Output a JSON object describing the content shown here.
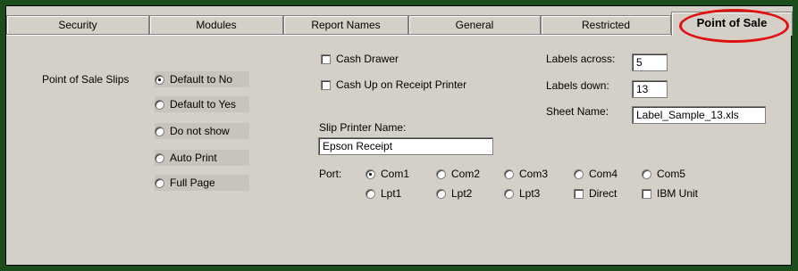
{
  "tabs": [
    {
      "label": "Security"
    },
    {
      "label": "Modules"
    },
    {
      "label": "Report Names"
    },
    {
      "label": "General"
    },
    {
      "label": "Restricted"
    },
    {
      "label": "Point of Sale",
      "active": true
    }
  ],
  "slips": {
    "label": "Point of Sale Slips",
    "options": [
      {
        "label": "Default to No",
        "selected": true
      },
      {
        "label": "Default to Yes",
        "selected": false
      },
      {
        "label": "Do not show",
        "selected": false
      },
      {
        "label": "Auto Print",
        "selected": false
      },
      {
        "label": "Full Page",
        "selected": false
      }
    ]
  },
  "checks": {
    "cash_drawer": {
      "label": "Cash Drawer",
      "checked": false
    },
    "cash_up": {
      "label": "Cash Up on Receipt Printer",
      "checked": false
    }
  },
  "slip_printer": {
    "label": "Slip Printer Name:",
    "value": "Epson Receipt"
  },
  "port": {
    "label": "Port:",
    "row1": [
      {
        "label": "Com1",
        "selected": true
      },
      {
        "label": "Com2",
        "selected": false
      },
      {
        "label": "Com3",
        "selected": false
      },
      {
        "label": "Com4",
        "selected": false
      },
      {
        "label": "Com5",
        "selected": false
      }
    ],
    "row2_radios": [
      {
        "label": "Lpt1",
        "selected": false
      },
      {
        "label": "Lpt2",
        "selected": false
      },
      {
        "label": "Lpt3",
        "selected": false
      }
    ],
    "row2_checks": [
      {
        "label": "Direct",
        "checked": false
      },
      {
        "label": "IBM Unit",
        "checked": false
      }
    ]
  },
  "labels": {
    "across_label": "Labels across:",
    "across_value": "5",
    "down_label": "Labels down:",
    "down_value": "13",
    "sheet_label": "Sheet Name:",
    "sheet_value": "Label_Sample_13.xls"
  },
  "colors": {
    "background": "#1a4d1a",
    "dialog": "#d4d0c8",
    "highlight": "#e01010"
  }
}
